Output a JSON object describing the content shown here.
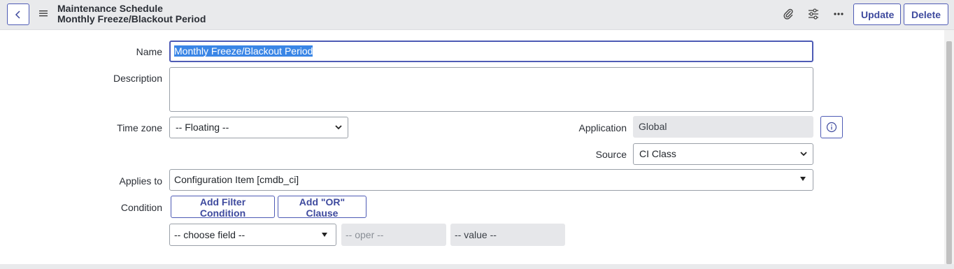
{
  "header": {
    "title": "Maintenance Schedule",
    "subtitle": "Monthly Freeze/Blackout Period",
    "update_label": "Update",
    "delete_label": "Delete"
  },
  "form": {
    "name": {
      "label": "Name",
      "value": "Monthly Freeze/Blackout Period"
    },
    "description": {
      "label": "Description",
      "value": ""
    },
    "time_zone": {
      "label": "Time zone",
      "value": "-- Floating --"
    },
    "application": {
      "label": "Application",
      "value": "Global"
    },
    "source": {
      "label": "Source",
      "value": "CI Class"
    },
    "applies_to": {
      "label": "Applies to",
      "value": "Configuration Item [cmdb_ci]"
    },
    "condition": {
      "label": "Condition",
      "add_filter_label": "Add Filter Condition",
      "add_or_label": "Add \"OR\" Clause",
      "field_placeholder": "-- choose field --",
      "oper_placeholder": "-- oper --",
      "value_placeholder": "-- value --"
    }
  },
  "colors": {
    "accent": "#4e5bb5",
    "header_bg": "#e9eaec",
    "selection": "#3a86e6"
  }
}
